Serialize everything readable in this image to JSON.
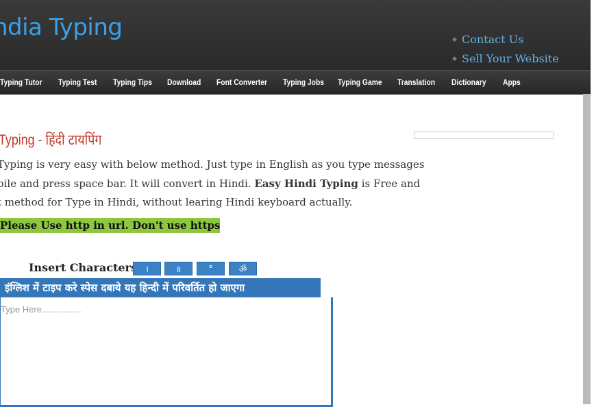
{
  "header": {
    "logo_text": "ndia Typing",
    "links": [
      "Contact Us",
      "Sell Your Website"
    ]
  },
  "nav": {
    "items": [
      "Typing Tutor",
      "Typing Test",
      "Typing Tips",
      "Download",
      "Font Converter",
      "Typing Jobs",
      "Typing Game",
      "Translation",
      "Dictionary",
      "Apps"
    ]
  },
  "content": {
    "title": "Typing - हिंदी टायपिंग",
    "paragraph": {
      "line1": "Typing is very easy with below method. Just type in English as you type messages",
      "line2_a": "bile and press space bar. It will convert in Hindi. ",
      "line2_b": "Easy Hindi Typing",
      "line2_c": " is Free and",
      "line3": "t method for Type in Hindi, without learing Hindi keyboard actually."
    },
    "notice": "Please Use http in url. Don't use https"
  },
  "insert": {
    "label": "Insert Characters",
    "buttons": [
      "।",
      "॥",
      "°",
      "ॐ"
    ]
  },
  "editor": {
    "header": "इंग्लिश में टाइप करे स्पेस दबाये यह हिन्दी में परिवर्तित हो जाएगा",
    "placeholder": "Type Here................"
  },
  "colors": {
    "accent_blue": "#3476b8",
    "logo_blue": "#3aa0e8",
    "title_red": "#c0392b",
    "notice_green": "#8dc63f"
  }
}
